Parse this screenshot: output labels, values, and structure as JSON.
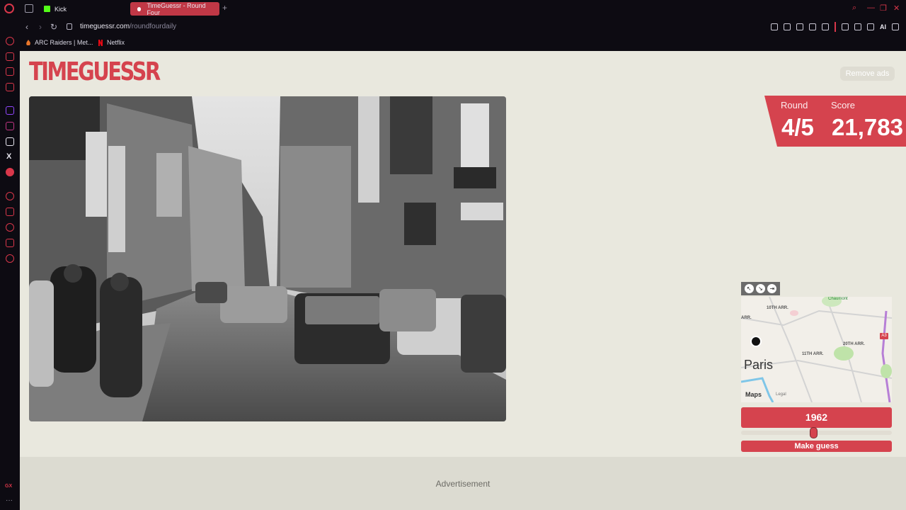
{
  "browser": {
    "tabs": [
      {
        "label": "Kick",
        "active": false
      },
      {
        "label": "TimeGuessr - Round Four",
        "active": true
      }
    ],
    "url_host": "timeguessr.com",
    "url_path": "/roundfourdaily",
    "ai_label": "AI",
    "bookmarks": [
      {
        "label": "ARC Raiders | Met..."
      },
      {
        "label": "Netflix"
      }
    ],
    "sidebar_gx": "GX",
    "sidebar_more": "···"
  },
  "header": {
    "logo": "TIMEGUESSR",
    "remove_ads": "Remove ads"
  },
  "score_panel": {
    "round_label": "Round",
    "round_value": "4/5",
    "score_label": "Score",
    "score_value": "21,783"
  },
  "map": {
    "city": "Paris",
    "brand": "Maps",
    "legal": "Legal",
    "place_label": "Chaumont",
    "road_badge": "A3",
    "district_labels": [
      "10TH ARR.",
      "11TH ARR.",
      "20TH ARR.",
      "ARR."
    ]
  },
  "guess": {
    "year": "1962",
    "slider_fraction": 0.48,
    "button_label": "Make guess"
  },
  "ad": {
    "label": "Advertisement"
  },
  "colors": {
    "brand_red": "#d5434e",
    "page_bg": "#e9e8de"
  }
}
